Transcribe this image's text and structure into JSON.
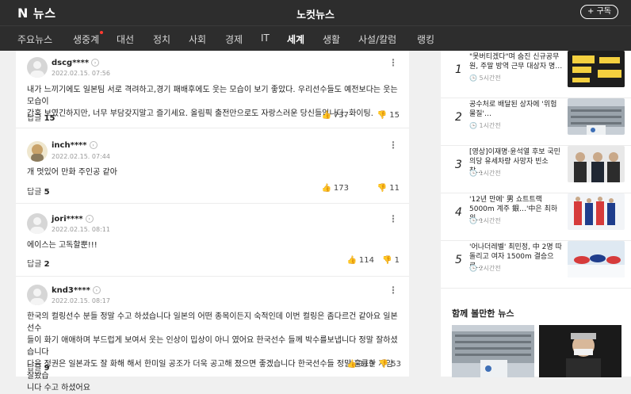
{
  "header": {
    "brand_n": "N",
    "brand": "뉴스",
    "section": "노컷뉴스",
    "subscribe": "+ 구독"
  },
  "nav": [
    {
      "label": "주요뉴스"
    },
    {
      "label": "생중계"
    },
    {
      "label": "대선"
    },
    {
      "label": "정치"
    },
    {
      "label": "사회"
    },
    {
      "label": "경제"
    },
    {
      "label": "IT"
    },
    {
      "label": "세계"
    },
    {
      "label": "생활"
    },
    {
      "label": "사설/칼럼"
    },
    {
      "label": "랭킹"
    }
  ],
  "comments": [
    {
      "user": "dscg****",
      "date": "2022.02.15. 07:56",
      "lines": [
        "내가 느끼기에도 일본팀 서로 격려하고,경기 패배후에도 웃는 모습이 보기 좋았다. 우리선수들도 예전보다는 웃는모습이",
        "간혹 보였긴하지만, 너무 부담갖지말고 즐기세요. 올림픽 출전만으로도 자랑스러운 당신들입니다. 화이팅."
      ],
      "reply_label": "답글",
      "reply_count": "15",
      "likes": "737",
      "dislikes": "15"
    },
    {
      "user": "inch****",
      "date": "2022.02.15. 07:44",
      "lines": [
        "개 멋있어 만화 주인공 같아"
      ],
      "reply_label": "답글",
      "reply_count": "5",
      "likes": "173",
      "dislikes": "11"
    },
    {
      "user": "jori****",
      "date": "2022.02.15. 08:11",
      "lines": [
        "에이스는 고독할뿐!!!"
      ],
      "reply_label": "답글",
      "reply_count": "2",
      "likes": "114",
      "dislikes": "1"
    },
    {
      "user": "knd3****",
      "date": "2022.02.15. 08:17",
      "lines": [
        "한국의 컬링선수 분들 정말 수고 하셨습니다 일본의 어떤 종목이든지 숙적인데 이번 컬링은 좀다르건 같아요 일본 선수",
        "들이 화기 애애하며 부드럽게 보여서 웃는 인상이 밉상이 아니 였어요 한국선수 들께 박수를보냅니다 정말 잘하셨습니다",
        "다음 정권은 일본과도 잘 화해 해서 한미일 공조가 더욱 공고해 졌으면 좋겠습니다 한국선수들 정말 훌륭한 게임 잘봤습",
        "니다 수고 하셨어요"
      ],
      "reply_label": "답글",
      "reply_count": "9",
      "likes": "119",
      "dislikes": "53"
    }
  ],
  "ranking": [
    {
      "num": "1",
      "title": "\"못버티겠다\"며 숨진 신규공무원, 주말 방역 근무 대상자 명…",
      "time": "5시간전"
    },
    {
      "num": "2",
      "title": "공수처로 배달된 상자에 '위험물질'…",
      "time": "1시간전"
    },
    {
      "num": "3",
      "title": "[영상]이재명·윤석열 후보 국민의당 유세차량 사망자 빈소 찾…",
      "time": "1시간전"
    },
    {
      "num": "4",
      "title": "'12년 만에' 男 쇼트트랙 5000m 계주 銀…'中은 최하위…",
      "time": "1시간전"
    },
    {
      "num": "5",
      "title": "'어나더레벨' 최민정, 中 2명 따돌리고 여자 1500m 결승으로…",
      "time": "2시간전"
    }
  ],
  "also_see": {
    "title": "함께 볼만한 뉴스"
  },
  "colors": {
    "header_bg": "#2d2d2d",
    "page_bg": "#f0f0f0",
    "new_dot": "#ff3b30"
  }
}
